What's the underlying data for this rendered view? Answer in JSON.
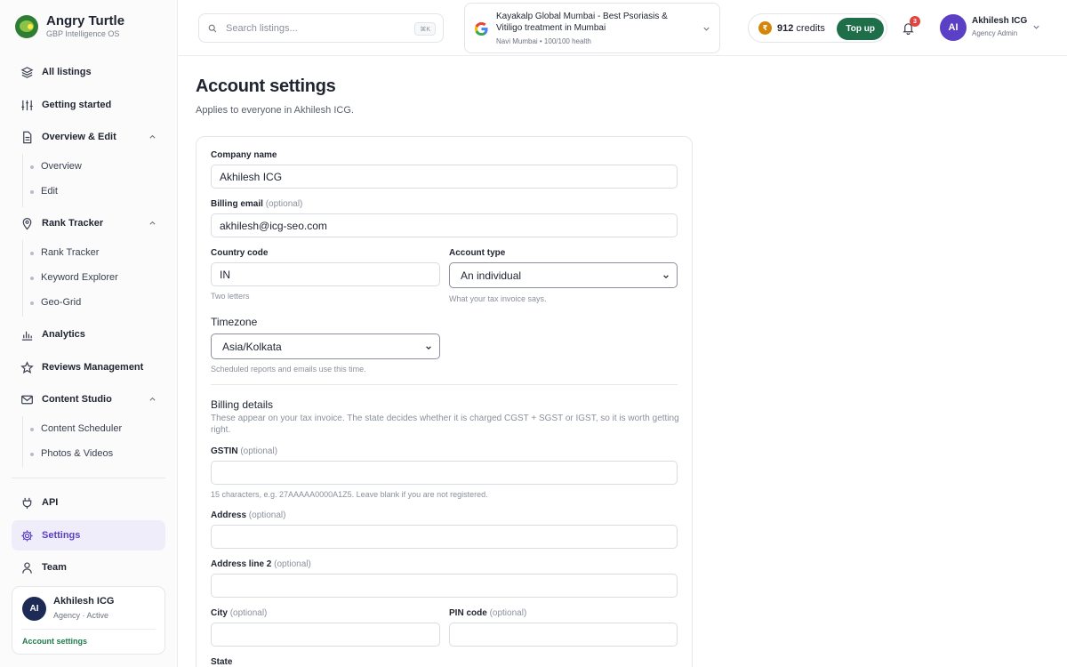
{
  "brand": {
    "name": "Angry Turtle",
    "subtitle": "GBP Intelligence OS"
  },
  "sidebar": {
    "all_listings": "All listings",
    "getting_started": "Getting started",
    "overview_edit": "Overview & Edit",
    "overview_sub": [
      "Overview",
      "Edit"
    ],
    "rank_tracker": "Rank Tracker",
    "rank_sub": [
      "Rank Tracker",
      "Keyword Explorer",
      "Geo-Grid"
    ],
    "analytics": "Analytics",
    "reviews": "Reviews Management",
    "content_studio": "Content Studio",
    "content_sub": [
      "Content Scheduler",
      "Photos & Videos"
    ],
    "api": "API",
    "settings": "Settings",
    "team": "Team",
    "user_card": {
      "initials": "AI",
      "name": "Akhilesh ICG",
      "role": "Agency · Active",
      "link": "Account settings"
    }
  },
  "topbar": {
    "search_placeholder": "Search listings...",
    "search_shortcut": "⌘K",
    "listing": {
      "title": "Kayakalp Global Mumbai - Best Psoriasis & Vitiligo treatment in Mumbai",
      "meta": "Navi Mumbai • 100/100 health"
    },
    "credits": {
      "symbol": "₹",
      "amount": "912",
      "unit": "credits",
      "topup": "Top up"
    },
    "notifications": "3",
    "user": {
      "initials": "AI",
      "name": "Akhilesh ICG",
      "role": "Agency Admin"
    }
  },
  "page": {
    "title": "Account settings",
    "subtitle": "Applies to everyone in Akhilesh ICG."
  },
  "form": {
    "company_label": "Company name",
    "company_value": "Akhilesh ICG",
    "billing_email_label": "Billing email",
    "optional": "(optional)",
    "billing_email_value": "akhilesh@icg-seo.com",
    "country_label": "Country code",
    "country_value": "IN",
    "country_hint": "Two letters",
    "account_type_label": "Account type",
    "account_type_value": "An individual",
    "account_type_hint": "What your tax invoice says.",
    "timezone_label": "Timezone",
    "timezone_value": "Asia/Kolkata",
    "timezone_hint": "Scheduled reports and emails use this time.",
    "billing_heading": "Billing details",
    "billing_desc": "These appear on your tax invoice. The state decides whether it is charged CGST + SGST or IGST, so it is worth getting right.",
    "gstin_label": "GSTIN",
    "gstin_hint": "15 characters, e.g. 27AAAAA0000A1Z5. Leave blank if you are not registered.",
    "address_label": "Address",
    "address2_label": "Address line 2",
    "city_label": "City",
    "pin_label": "PIN code",
    "state_label": "State"
  }
}
